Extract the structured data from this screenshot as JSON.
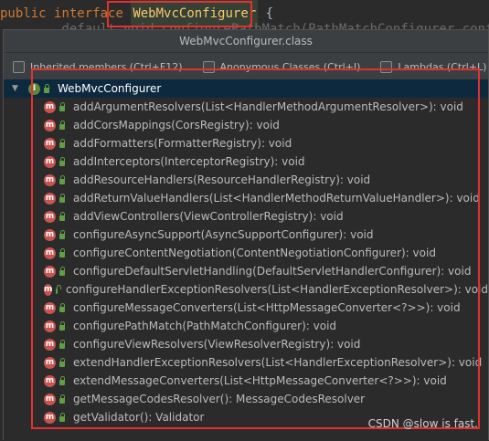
{
  "editor": {
    "kw_public": "public",
    "kw_interface": "interface",
    "class_name": "WebMvcConfigurer",
    "brace": "{",
    "next_line": "        default void configurePathMatch(PathMatchConfigurer configurer) {"
  },
  "popup": {
    "title": "WebMvcConfigurer.class",
    "filters": [
      "Inherited members (Ctrl+F12)",
      "Anonymous Classes (Ctrl+I)",
      "Lambdas (Ctrl+L)"
    ],
    "root": {
      "icon_letter": "I",
      "label": "WebMvcConfigurer"
    },
    "method_icon_letter": "m",
    "methods": [
      "addArgumentResolvers(List<HandlerMethodArgumentResolver>): void",
      "addCorsMappings(CorsRegistry): void",
      "addFormatters(FormatterRegistry): void",
      "addInterceptors(InterceptorRegistry): void",
      "addResourceHandlers(ResourceHandlerRegistry): void",
      "addReturnValueHandlers(List<HandlerMethodReturnValueHandler>): void",
      "addViewControllers(ViewControllerRegistry): void",
      "configureAsyncSupport(AsyncSupportConfigurer): void",
      "configureContentNegotiation(ContentNegotiationConfigurer): void",
      "configureDefaultServletHandling(DefaultServletHandlerConfigurer): void",
      "configureHandlerExceptionResolvers(List<HandlerExceptionResolver>): void",
      "configureMessageConverters(List<HttpMessageConverter<?>>): void",
      "configurePathMatch(PathMatchConfigurer): void",
      "configureViewResolvers(ViewResolverRegistry): void",
      "extendHandlerExceptionResolvers(List<HandlerExceptionResolver>): void",
      "extendMessageConverters(List<HttpMessageConverter<?>>): void",
      "getMessageCodesResolver(): MessageCodesResolver",
      "getValidator(): Validator"
    ]
  },
  "watermark": "CSDN @slow is fast."
}
